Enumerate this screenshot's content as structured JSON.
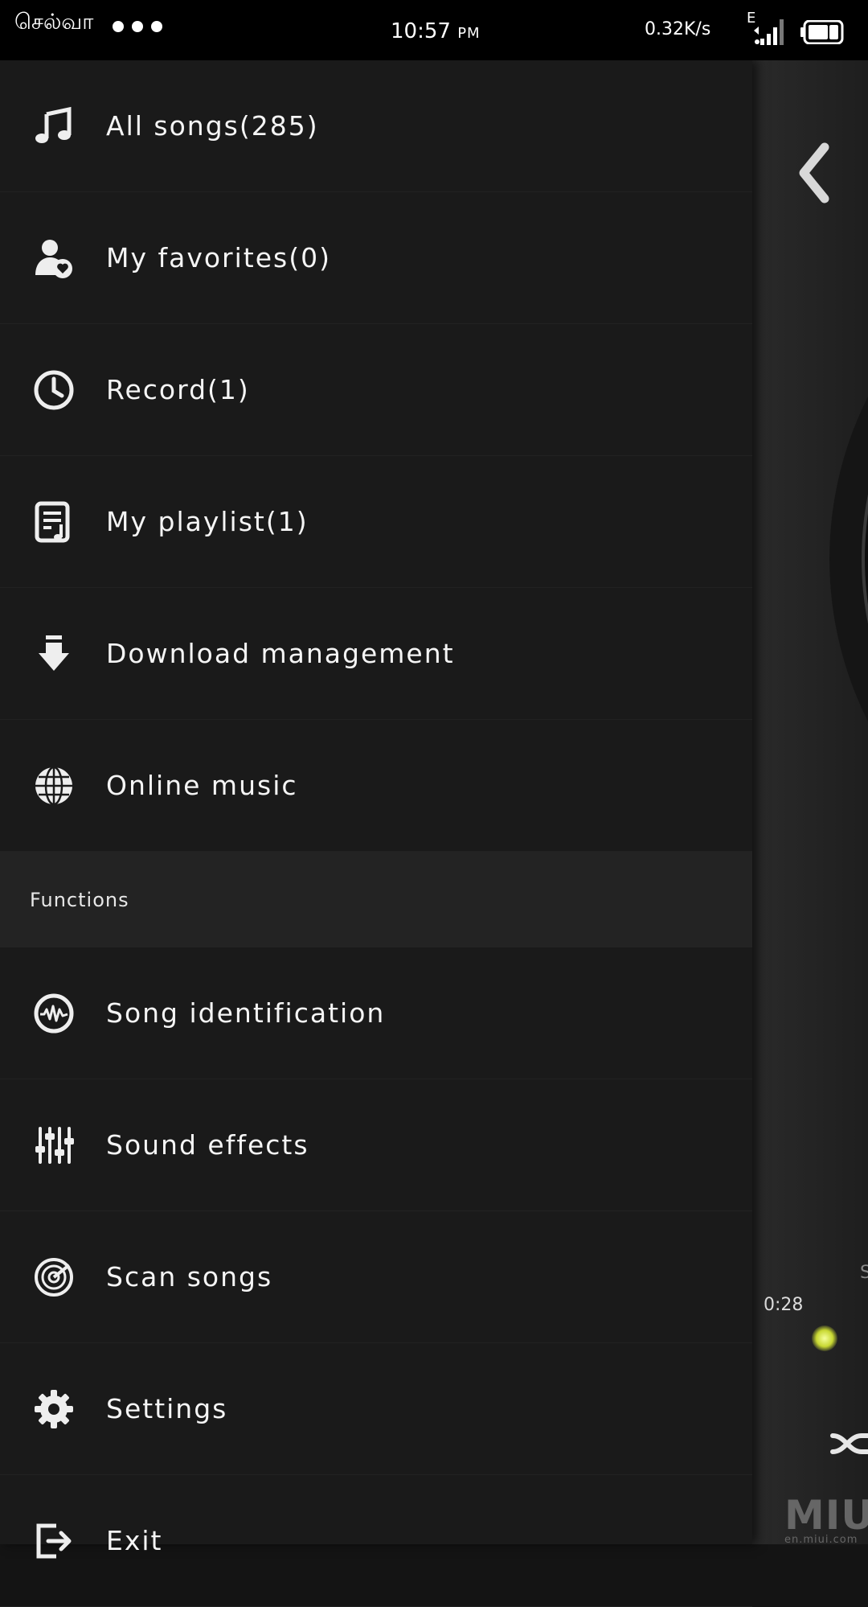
{
  "status_bar": {
    "carrier": "செல்வா",
    "time": "10:57",
    "ampm": "PM",
    "speed": "0.32K/s",
    "network_type": "E"
  },
  "drawer": {
    "items": [
      {
        "label": "All songs(285)",
        "icon": "music-note-icon"
      },
      {
        "label": "My favorites(0)",
        "icon": "favorite-person-icon"
      },
      {
        "label": "Record(1)",
        "icon": "clock-icon"
      },
      {
        "label": "My playlist(1)",
        "icon": "playlist-icon"
      },
      {
        "label": "Download management",
        "icon": "download-icon"
      },
      {
        "label": "Online music",
        "icon": "globe-icon"
      }
    ],
    "section_title": "Functions",
    "functions": [
      {
        "label": "Song identification",
        "icon": "waveform-icon"
      },
      {
        "label": "Sound effects",
        "icon": "equalizer-icon"
      },
      {
        "label": "Scan songs",
        "icon": "radar-icon"
      },
      {
        "label": "Settings",
        "icon": "gear-icon"
      },
      {
        "label": "Exit",
        "icon": "exit-icon"
      }
    ]
  },
  "player": {
    "elapsed": "0:28",
    "watermark": "MIUI",
    "watermark_site": "en.miui.com",
    "partial_text": "S"
  }
}
